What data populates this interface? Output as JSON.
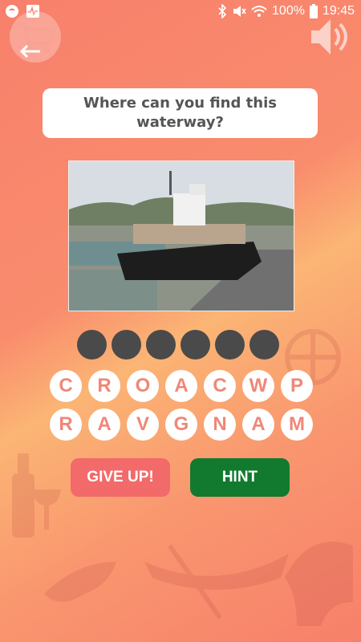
{
  "status_bar": {
    "battery": "100%",
    "time": "19:45"
  },
  "header": {
    "cart_icon": "shopping-cart-icon",
    "back_icon": "back-arrow-icon",
    "sound_icon": "speaker-icon"
  },
  "question": {
    "text": "Where can you find this waterway?"
  },
  "image": {
    "subject": "container ship in canal lock"
  },
  "answer": {
    "slot_count": 6
  },
  "letters": {
    "row1": [
      "C",
      "R",
      "O",
      "A",
      "C",
      "W",
      "P"
    ],
    "row2": [
      "R",
      "A",
      "V",
      "G",
      "N",
      "A",
      "M"
    ]
  },
  "buttons": {
    "give_up": "GIVE UP!",
    "hint": "HINT"
  },
  "colors": {
    "giveup": "#f26a6a",
    "hint": "#127a2e",
    "slot": "#4a4a4a",
    "letter_text": "#f08777"
  }
}
